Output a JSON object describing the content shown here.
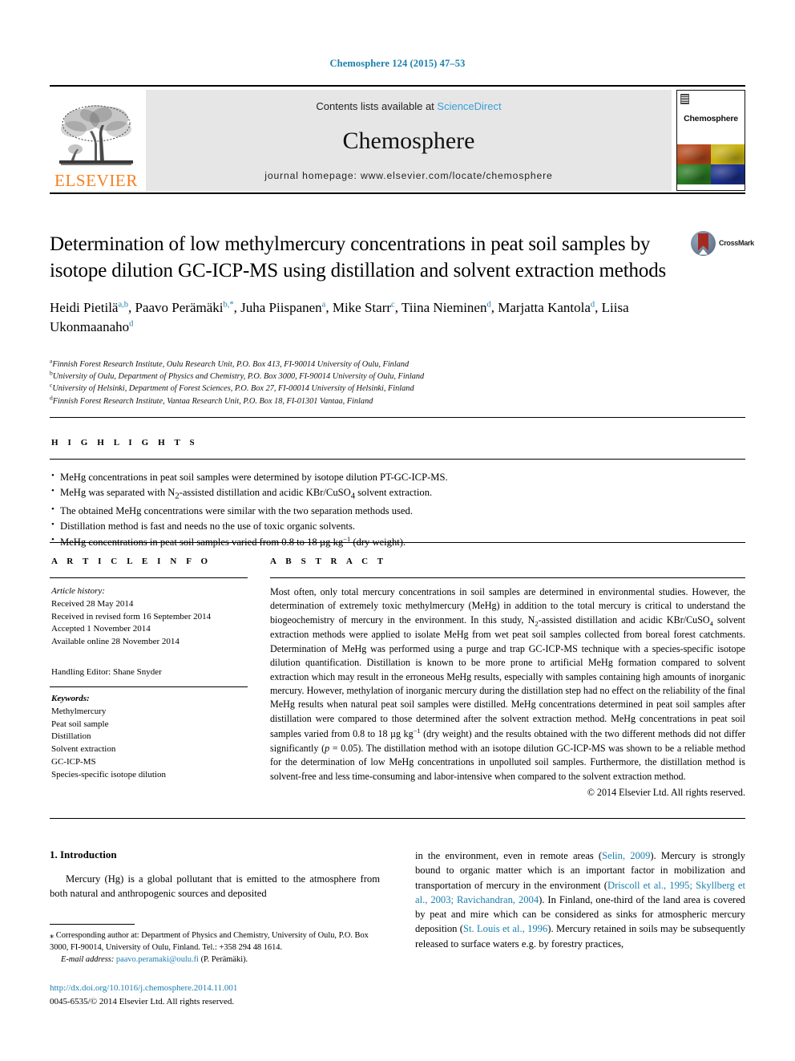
{
  "running_head": "Chemosphere 124 (2015) 47–53",
  "masthead": {
    "publisher": "ELSEVIER",
    "contents_prefix": "Contents lists available at ",
    "sciencedirect": "ScienceDirect",
    "journal_name": "Chemosphere",
    "homepage": "journal homepage: www.elsevier.com/locate/chemosphere",
    "cover_title": "Chemosphere"
  },
  "crossmark": {
    "label": "CrossMark"
  },
  "article": {
    "title": "Determination of low methylmercury concentrations in peat soil samples by isotope dilution GC-ICP-MS using distillation and solvent extraction methods",
    "authors": [
      {
        "name": "Heidi Pietilä",
        "sup": "a,b",
        "sep": ", "
      },
      {
        "name": "Paavo Perämäki",
        "sup": "b,*",
        "sep": ", "
      },
      {
        "name": "Juha Piispanen",
        "sup": "a",
        "sep": ", "
      },
      {
        "name": "Mike Starr",
        "sup": "c",
        "sep": ", "
      },
      {
        "name": "Tiina Nieminen",
        "sup": "d",
        "sep": ", "
      },
      {
        "name": "Marjatta Kantola",
        "sup": "d",
        "sep": ", "
      },
      {
        "name": "Liisa Ukonmaanaho",
        "sup": "d",
        "sep": ""
      }
    ],
    "affiliations": [
      {
        "mark": "a",
        "text": "Finnish Forest Research Institute, Oulu Research Unit, P.O. Box 413, FI-90014 University of Oulu, Finland"
      },
      {
        "mark": "b",
        "text": "University of Oulu, Department of Physics and Chemistry, P.O. Box 3000, FI-90014 University of Oulu, Finland"
      },
      {
        "mark": "c",
        "text": "University of Helsinki, Department of Forest Sciences, P.O. Box 27, FI-00014 University of Helsinki, Finland"
      },
      {
        "mark": "d",
        "text": "Finnish Forest Research Institute, Vantaa Research Unit, P.O. Box 18, FI-01301 Vantaa, Finland"
      }
    ]
  },
  "highlights": {
    "heading": "H I G H L I G H T S",
    "items": [
      "MeHg concentrations in peat soil samples were determined by isotope dilution PT-GC-ICP-MS.",
      "MeHg was separated with N2-assisted distillation and acidic KBr/CuSO4 solvent extraction.",
      "The obtained MeHg concentrations were similar with the two separation methods used.",
      "Distillation method is fast and needs no the use of toxic organic solvents.",
      "MeHg concentrations in peat soil samples varied from 0.8 to 18 µg kg−1 (dry weight)."
    ]
  },
  "article_info": {
    "heading": "A R T I C L E   I N F O",
    "history_label": "Article history:",
    "history": [
      "Received 28 May 2014",
      "Received in revised form 16 September 2014",
      "Accepted 1 November 2014",
      "Available online 28 November 2014"
    ],
    "handling_editor": "Handling Editor: Shane Snyder",
    "keywords_label": "Keywords:",
    "keywords": [
      "Methylmercury",
      "Peat soil sample",
      "Distillation",
      "Solvent extraction",
      "GC-ICP-MS",
      "Species-specific isotope dilution"
    ]
  },
  "abstract": {
    "heading": "A B S T R A C T",
    "text": "Most often, only total mercury concentrations in soil samples are determined in environmental studies. However, the determination of extremely toxic methylmercury (MeHg) in addition to the total mercury is critical to understand the biogeochemistry of mercury in the environment. In this study, N2-assisted distillation and acidic KBr/CuSO4 solvent extraction methods were applied to isolate MeHg from wet peat soil samples collected from boreal forest catchments. Determination of MeHg was performed using a purge and trap GC-ICP-MS technique with a species-specific isotope dilution quantification. Distillation is known to be more prone to artificial MeHg formation compared to solvent extraction which may result in the erroneous MeHg results, especially with samples containing high amounts of inorganic mercury. However, methylation of inorganic mercury during the distillation step had no effect on the reliability of the final MeHg results when natural peat soil samples were distilled. MeHg concentrations determined in peat soil samples after distillation were compared to those determined after the solvent extraction method. MeHg concentrations in peat soil samples varied from 0.8 to 18 µg kg−1 (dry weight) and the results obtained with the two different methods did not differ significantly (p = 0.05). The distillation method with an isotope dilution GC-ICP-MS was shown to be a reliable method for the determination of low MeHg concentrations in unpolluted soil samples. Furthermore, the distillation method is solvent-free and less time-consuming and labor-intensive when compared to the solvent extraction method.",
    "copyright": "© 2014 Elsevier Ltd. All rights reserved."
  },
  "body": {
    "section_number_title": "1. Introduction",
    "left_paragraph": "Mercury (Hg) is a global pollutant that is emitted to the atmosphere from both natural and anthropogenic sources and deposited",
    "right_paragraph_parts": [
      {
        "type": "text",
        "value": "in the environment, even in remote areas ("
      },
      {
        "type": "link",
        "value": "Selin, 2009"
      },
      {
        "type": "text",
        "value": "). Mercury is strongly bound to organic matter which is an important factor in mobilization and transportation of mercury in the environment ("
      },
      {
        "type": "link",
        "value": "Driscoll et al., 1995; Skyllberg et al., 2003; Ravichandran, 2004"
      },
      {
        "type": "text",
        "value": "). In Finland, one-third of the land area is covered by peat and mire which can be considered as sinks for atmospheric mercury deposition ("
      },
      {
        "type": "link",
        "value": "St. Louis et al., 1996"
      },
      {
        "type": "text",
        "value": "). Mercury retained in soils may be subsequently released to surface waters e.g. by forestry practices,"
      }
    ]
  },
  "footnote": {
    "corresponding": "⁎ Corresponding author at: Department of Physics and Chemistry, University of Oulu, P.O. Box 3000, FI-90014, University of Oulu, Finland. Tel.: +358 294 48 1614.",
    "email_label": "E-mail address:",
    "email": "paavo.peramaki@oulu.fi",
    "email_suffix": "(P. Perämäki)."
  },
  "doi": {
    "url": "http://dx.doi.org/10.1016/j.chemosphere.2014.11.001",
    "issn_line": "0045-6535/© 2014 Elsevier Ltd. All rights reserved."
  }
}
